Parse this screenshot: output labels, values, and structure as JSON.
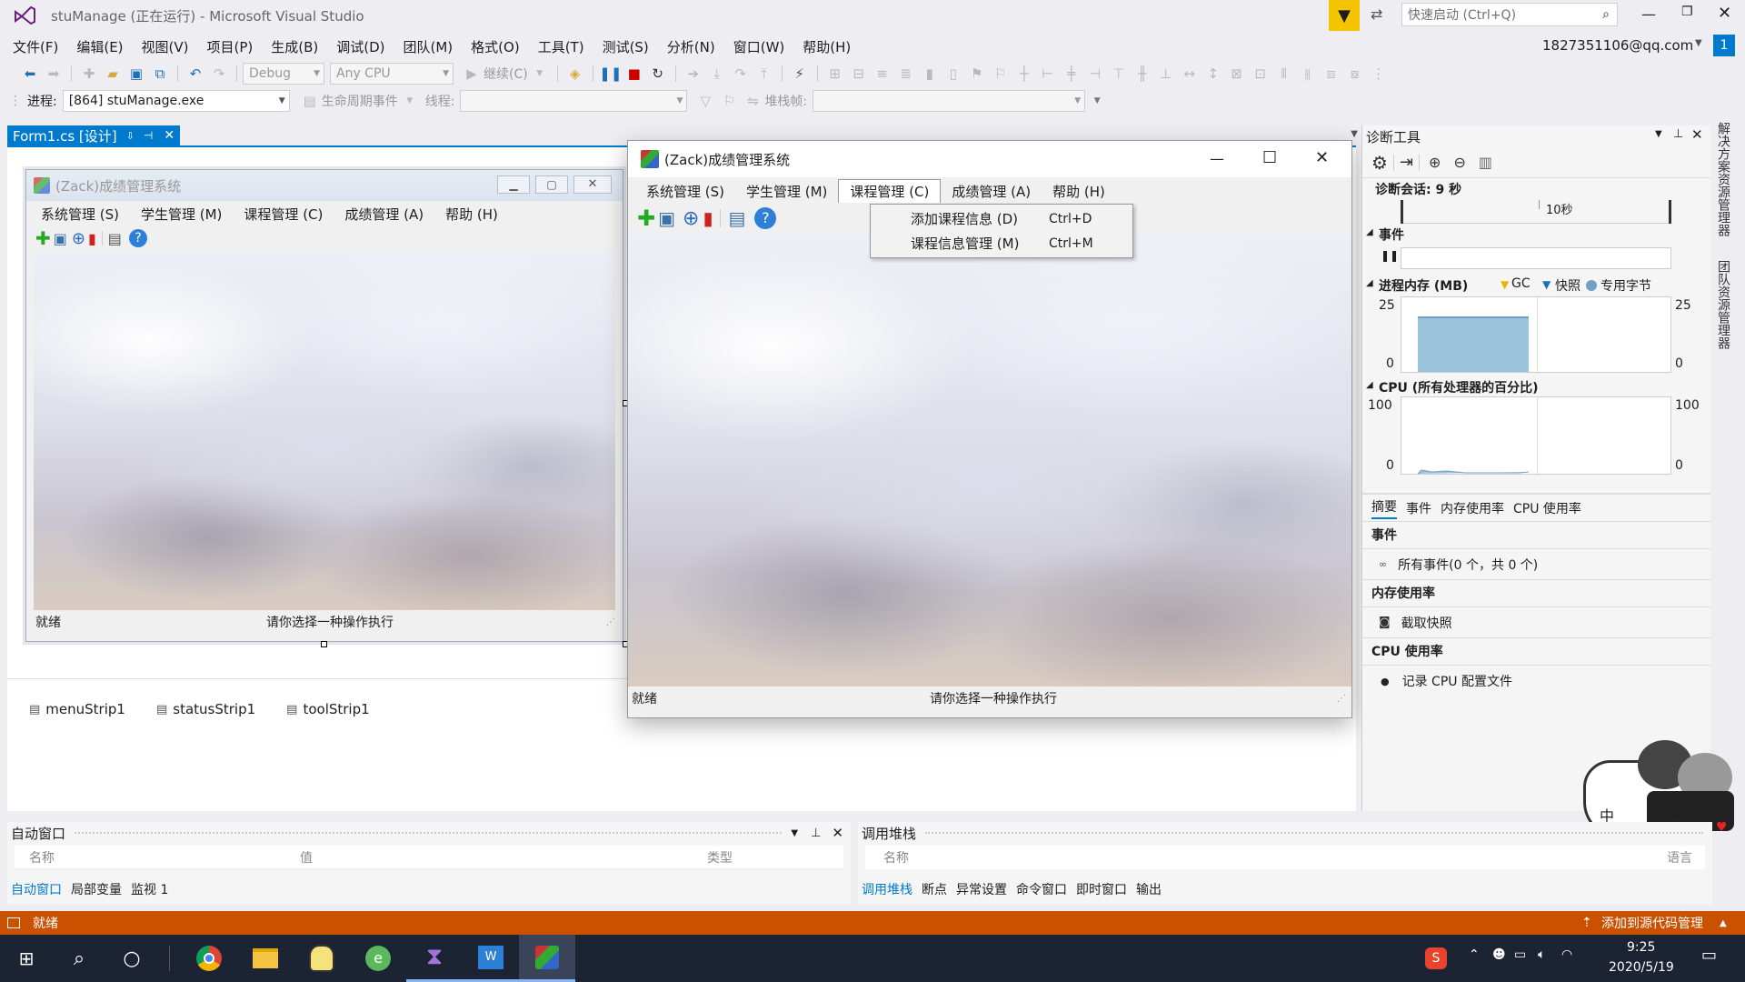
{
  "titlebar": {
    "title": "stuManage (正在运行) - Microsoft Visual Studio",
    "quick_launch_placeholder": "快速启动 (Ctrl+Q)"
  },
  "menubar": [
    "文件(F)",
    "编辑(E)",
    "视图(V)",
    "项目(P)",
    "生成(B)",
    "调试(D)",
    "团队(M)",
    "格式(O)",
    "工具(T)",
    "测试(S)",
    "分析(N)",
    "窗口(W)",
    "帮助(H)"
  ],
  "account": {
    "email": "1827351106@qq.com",
    "badge": "1"
  },
  "toolbar": {
    "config": "Debug",
    "platform": "Any CPU",
    "continue_label": "继续(C)"
  },
  "debugbar": {
    "process_label": "进程:",
    "process_value": "[864] stuManage.exe",
    "lifecycle_label": "生命周期事件",
    "thread_label": "线程:",
    "stackframe_label": "堆栈帧:"
  },
  "doc_tab": {
    "label": "Form1.cs [设计]"
  },
  "form": {
    "title": "(Zack)成绩管理系统",
    "menus": [
      "系统管理 (S)",
      "学生管理 (M)",
      "课程管理 (C)",
      "成绩管理 (A)",
      "帮助 (H)"
    ],
    "status_left": "就绪",
    "status_right": "请你选择一种操作执行"
  },
  "tray_components": [
    "menuStrip1",
    "statusStrip1",
    "toolStrip1"
  ],
  "runtime_form": {
    "title": "(Zack)成绩管理系统",
    "menus": [
      "系统管理 (S)",
      "学生管理 (M)",
      "课程管理 (C)",
      "成绩管理 (A)",
      "帮助 (H)"
    ],
    "active_menu_index": 2,
    "dropdown": [
      {
        "label": "添加课程信息 (D)",
        "shortcut": "Ctrl+D"
      },
      {
        "label": "课程信息管理 (M)",
        "shortcut": "Ctrl+M"
      }
    ],
    "status_left": "就绪",
    "status_right": "请你选择一种操作执行"
  },
  "diagnostics": {
    "title": "诊断工具",
    "session": "诊断会话: 9 秒",
    "timeline_label": "10秒",
    "events_title": "事件",
    "memory_title": "进程内存 (MB)",
    "legend": [
      "GC",
      "快照",
      "专用字节"
    ],
    "mem_max": "25",
    "mem_min": "0",
    "cpu_title": "CPU (所有处理器的百分比)",
    "cpu_max": "100",
    "cpu_min": "0",
    "tabs": [
      "摘要",
      "事件",
      "内存使用率",
      "CPU 使用率"
    ],
    "sec_events": "事件",
    "all_events": "所有事件(0 个，共 0 个)",
    "sec_memory": "内存使用率",
    "snapshot": "截取快照",
    "sec_cpu": "CPU 使用率",
    "record_cpu": "记录 CPU 配置文件",
    "mem_level": 0.95
  },
  "side_tabs": [
    "解决方案资源管理器",
    "团队资源管理器"
  ],
  "autos": {
    "title": "自动窗口",
    "cols": [
      "名称",
      "值",
      "类型"
    ],
    "tabs": [
      "自动窗口",
      "局部变量",
      "监视 1"
    ]
  },
  "callstack": {
    "title": "调用堆栈",
    "cols": [
      "名称",
      "语言"
    ],
    "tabs": [
      "调用堆栈",
      "断点",
      "异常设置",
      "命令窗口",
      "即时窗口",
      "输出"
    ]
  },
  "statusbar": {
    "left": "就绪",
    "right": "添加到源代码管理",
    "color": "#ca5100"
  },
  "taskbar": {
    "time": "9:25",
    "date": "2020/5/19"
  },
  "colors": {
    "accent": "#007acc",
    "status": "#ca5100",
    "taskbar": "#1c2434"
  }
}
